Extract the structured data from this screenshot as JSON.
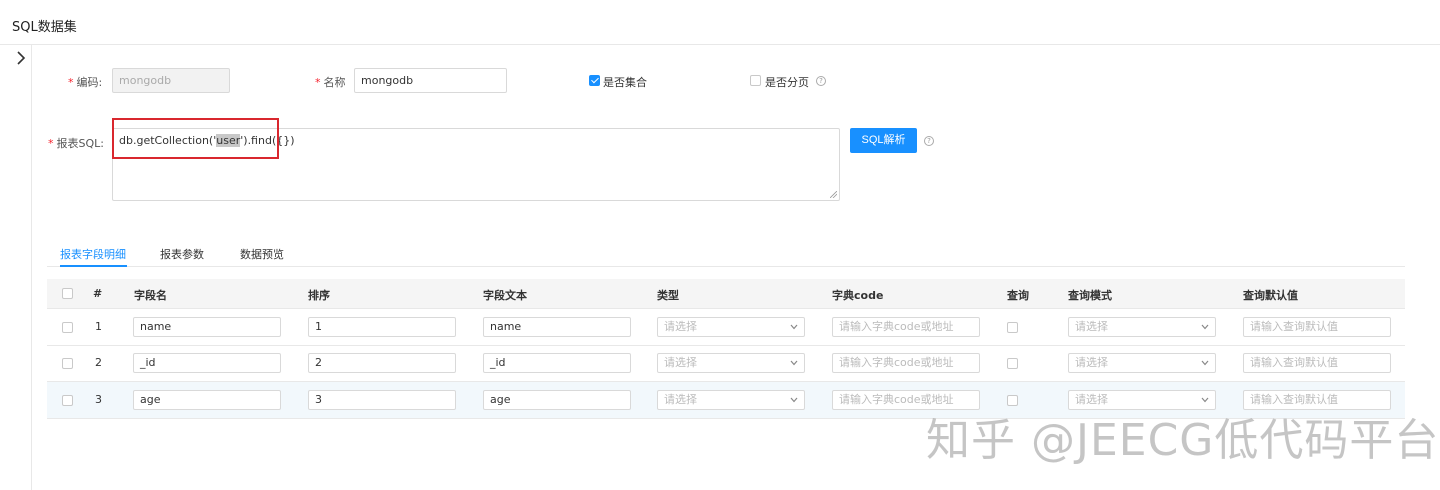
{
  "page_title": "SQL数据集",
  "form": {
    "code": {
      "label": "编码:",
      "value": "mongodb"
    },
    "name": {
      "label": "名称",
      "value": "mongodb"
    },
    "is_collection": {
      "label": "是否集合",
      "checked": true
    },
    "is_paged": {
      "label": "是否分页",
      "checked": false
    },
    "sql": {
      "label": "报表SQL:",
      "prefix": "db.getCollection('",
      "highlight": "user",
      "suffix": "').find({})"
    },
    "parse_button": "SQL解析",
    "help_glyph": "?"
  },
  "tabs": [
    {
      "label": "报表字段明细",
      "active": true
    },
    {
      "label": "报表参数",
      "active": false
    },
    {
      "label": "数据预览",
      "active": false
    }
  ],
  "table": {
    "columns": [
      "#",
      "字段名",
      "排序",
      "字段文本",
      "类型",
      "字典code",
      "查询",
      "查询模式",
      "查询默认值"
    ],
    "select_placeholder": "请选择",
    "dict_placeholder": "请输入字典code或地址",
    "default_placeholder": "请输入查询默认值",
    "rows": [
      {
        "index": "1",
        "field": "name",
        "order": "1",
        "text": "name"
      },
      {
        "index": "2",
        "field": "_id",
        "order": "2",
        "text": "_id"
      },
      {
        "index": "3",
        "field": "age",
        "order": "3",
        "text": "age"
      }
    ]
  },
  "watermark": "知乎 @JEECG低代码平台",
  "colors": {
    "primary": "#1890ff",
    "highlight_box": "#d9272e"
  }
}
